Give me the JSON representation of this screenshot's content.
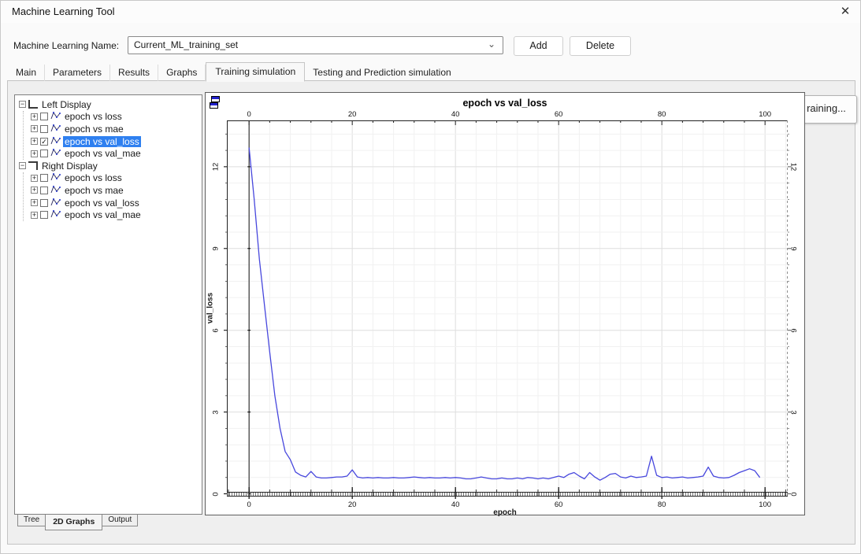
{
  "window": {
    "title": "Machine Learning Tool",
    "close_glyph": "✕"
  },
  "toolbar": {
    "name_label": "Machine Learning Name:",
    "name_value": "Current_ML_training_set",
    "chevron_glyph": "⌄",
    "add_label": "Add",
    "delete_label": "Delete"
  },
  "tabs": {
    "items": [
      "Main",
      "Parameters",
      "Results",
      "Graphs",
      "Training simulation",
      "Testing and Prediction simulation"
    ],
    "active": "Training simulation"
  },
  "tree": {
    "groups": [
      {
        "label": "Left Display",
        "icon": "left-display-axes",
        "children": [
          {
            "label": "epoch vs loss",
            "checked": false,
            "selected": false
          },
          {
            "label": "epoch vs mae",
            "checked": false,
            "selected": false
          },
          {
            "label": "epoch vs val_loss",
            "checked": true,
            "selected": true
          },
          {
            "label": "epoch vs val_mae",
            "checked": false,
            "selected": false
          }
        ]
      },
      {
        "label": "Right Display",
        "icon": "right-display-axes",
        "children": [
          {
            "label": "epoch vs loss",
            "checked": false,
            "selected": false
          },
          {
            "label": "epoch vs mae",
            "checked": false,
            "selected": false
          },
          {
            "label": "epoch vs val_loss",
            "checked": false,
            "selected": false
          },
          {
            "label": "epoch vs val_mae",
            "checked": false,
            "selected": false
          }
        ]
      }
    ]
  },
  "bottom_tabs": {
    "items": [
      {
        "label": "Tree",
        "active": false
      },
      {
        "label": "2D Graphs",
        "active": true
      },
      {
        "label": "Output",
        "active": false
      }
    ]
  },
  "side_button": {
    "label": "raining..."
  },
  "colors": {
    "accent": "#2f80f0",
    "line": "#4747dd",
    "grid_minor": "#f1f1f1",
    "grid_major": "#dedede"
  },
  "chart_data": {
    "type": "line",
    "title": "epoch vs val_loss",
    "xlabel": "epoch",
    "ylabel": "val_loss",
    "x_ticks": [
      0,
      20,
      40,
      60,
      80,
      100
    ],
    "y_ticks": [
      0,
      3,
      6,
      9,
      12
    ],
    "xlim": [
      -4.3,
      104.4
    ],
    "ylim": [
      -0.1,
      13.7
    ],
    "grid": true,
    "legend": false,
    "x": [
      0,
      1,
      2,
      3,
      4,
      5,
      6,
      7,
      8,
      9,
      10,
      11,
      12,
      13,
      14,
      15,
      16,
      17,
      18,
      19,
      20,
      21,
      22,
      23,
      24,
      25,
      26,
      27,
      28,
      29,
      30,
      31,
      32,
      33,
      34,
      35,
      36,
      37,
      38,
      39,
      40,
      41,
      42,
      43,
      44,
      45,
      46,
      47,
      48,
      49,
      50,
      51,
      52,
      53,
      54,
      55,
      56,
      57,
      58,
      59,
      60,
      61,
      62,
      63,
      64,
      65,
      66,
      67,
      68,
      69,
      70,
      71,
      72,
      73,
      74,
      75,
      76,
      77,
      78,
      79,
      80,
      81,
      82,
      83,
      84,
      85,
      86,
      87,
      88,
      89,
      90,
      91,
      92,
      93,
      94,
      95,
      96,
      97,
      98,
      99
    ],
    "y": [
      12.7,
      10.8,
      8.6,
      6.9,
      5.2,
      3.6,
      2.4,
      1.55,
      1.25,
      0.8,
      0.68,
      0.62,
      0.82,
      0.62,
      0.58,
      0.58,
      0.6,
      0.62,
      0.62,
      0.65,
      0.88,
      0.62,
      0.58,
      0.6,
      0.58,
      0.6,
      0.58,
      0.58,
      0.6,
      0.58,
      0.58,
      0.6,
      0.62,
      0.6,
      0.58,
      0.6,
      0.58,
      0.58,
      0.6,
      0.58,
      0.6,
      0.58,
      0.55,
      0.55,
      0.58,
      0.62,
      0.58,
      0.55,
      0.55,
      0.58,
      0.55,
      0.55,
      0.58,
      0.55,
      0.6,
      0.58,
      0.55,
      0.58,
      0.55,
      0.6,
      0.65,
      0.6,
      0.72,
      0.78,
      0.65,
      0.55,
      0.78,
      0.62,
      0.5,
      0.6,
      0.72,
      0.75,
      0.62,
      0.58,
      0.65,
      0.6,
      0.62,
      0.65,
      1.38,
      0.68,
      0.6,
      0.62,
      0.58,
      0.6,
      0.62,
      0.58,
      0.6,
      0.62,
      0.65,
      0.98,
      0.65,
      0.6,
      0.58,
      0.6,
      0.68,
      0.78,
      0.85,
      0.92,
      0.85,
      0.6
    ]
  }
}
